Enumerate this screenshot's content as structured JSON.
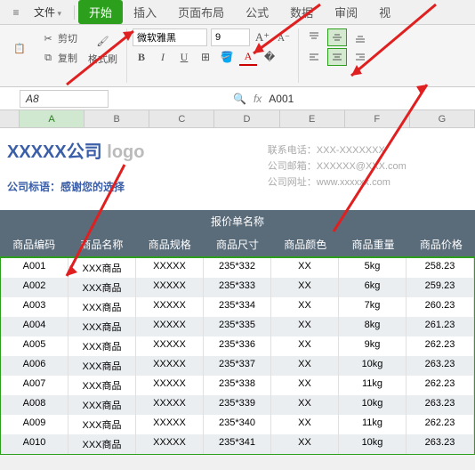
{
  "tabs": {
    "file": "文件",
    "home": "开始",
    "insert": "插入",
    "layout": "页面布局",
    "formula": "公式",
    "data": "数据",
    "review": "审阅",
    "view": "视"
  },
  "clipboard": {
    "cut": "剪切",
    "copy": "复制",
    "paste": "格式刷"
  },
  "font": {
    "name": "微软雅黑",
    "size": "9"
  },
  "namebox": {
    "cell": "A8",
    "formula": "A001"
  },
  "columns": [
    "A",
    "B",
    "C",
    "D",
    "E",
    "F",
    "G"
  ],
  "company": {
    "name": "XXXXX公司",
    "logo": "logo",
    "slogan": "公司标语：感谢您的选择",
    "phone_label": "联系电话：",
    "phone": "XXX-XXXXXXX",
    "email_label": "公司邮箱：",
    "email": "XXXXXX@XXX.com",
    "web_label": "公司网址：",
    "web": "www.xxxxxx.com"
  },
  "quote": {
    "title": "报价单名称",
    "headers": [
      "商品编码",
      "商品名称",
      "商品规格",
      "商品尺寸",
      "商品颜色",
      "商品重量",
      "商品价格"
    ],
    "rows": [
      [
        "A001",
        "XXX商品",
        "XXXXX",
        "235*332",
        "XX",
        "5kg",
        "258.23"
      ],
      [
        "A002",
        "XXX商品",
        "XXXXX",
        "235*333",
        "XX",
        "6kg",
        "259.23"
      ],
      [
        "A003",
        "XXX商品",
        "XXXXX",
        "235*334",
        "XX",
        "7kg",
        "260.23"
      ],
      [
        "A004",
        "XXX商品",
        "XXXXX",
        "235*335",
        "XX",
        "8kg",
        "261.23"
      ],
      [
        "A005",
        "XXX商品",
        "XXXXX",
        "235*336",
        "XX",
        "9kg",
        "262.23"
      ],
      [
        "A006",
        "XXX商品",
        "XXXXX",
        "235*337",
        "XX",
        "10kg",
        "263.23"
      ],
      [
        "A007",
        "XXX商品",
        "XXXXX",
        "235*338",
        "XX",
        "11kg",
        "262.23"
      ],
      [
        "A008",
        "XXX商品",
        "XXXXX",
        "235*339",
        "XX",
        "10kg",
        "263.23"
      ],
      [
        "A009",
        "XXX商品",
        "XXXXX",
        "235*340",
        "XX",
        "11kg",
        "262.23"
      ],
      [
        "A010",
        "XXX商品",
        "XXXXX",
        "235*341",
        "XX",
        "10kg",
        "263.23"
      ]
    ]
  }
}
